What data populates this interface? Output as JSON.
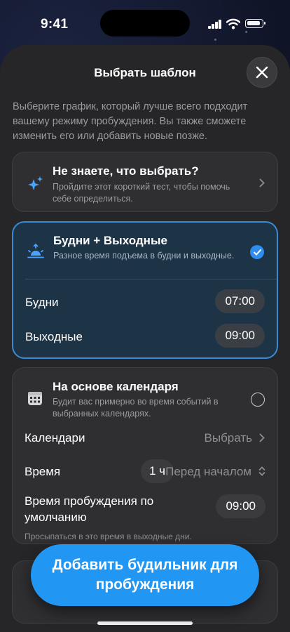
{
  "status": {
    "time": "9:41"
  },
  "sheet": {
    "title": "Выбрать шаблон",
    "intro": "Выберите график, который лучше всего подходит вашему режиму пробуждения. Вы также сможете изменить его или добавить новые позже."
  },
  "quiz": {
    "title": "Не знаете, что выбрать?",
    "subtitle": "Пройдите этот короткий тест, чтобы помочь себе определиться.",
    "icon": "sparkles-icon"
  },
  "weekdays_template": {
    "title": "Будни + Выходные",
    "subtitle": "Разное время подъема в будни и выходные.",
    "selected": true,
    "icon": "sunrise-icon",
    "rows": [
      {
        "label": "Будни",
        "value": "07:00"
      },
      {
        "label": "Выходные",
        "value": "09:00"
      }
    ]
  },
  "calendar_template": {
    "title": "На основе календаря",
    "subtitle": "Будит вас примерно во время событий в выбранных календарях.",
    "selected": false,
    "icon": "calendar-icon",
    "calendars_label": "Календари",
    "calendars_value": "Выбрать",
    "time_label": "Время",
    "time_offset": "1 ч",
    "time_mode": "Перед началом",
    "default_label": "Время пробуждения по умолчанию",
    "default_value": "09:00",
    "note": "Просыпаться в это время в выходные дни."
  },
  "cta": {
    "label": "Добавить будильник для пробуждения"
  },
  "colors": {
    "accent": "#2f8cf0",
    "selected_bg": "#1d3346",
    "selected_border": "#3b8ad6"
  }
}
